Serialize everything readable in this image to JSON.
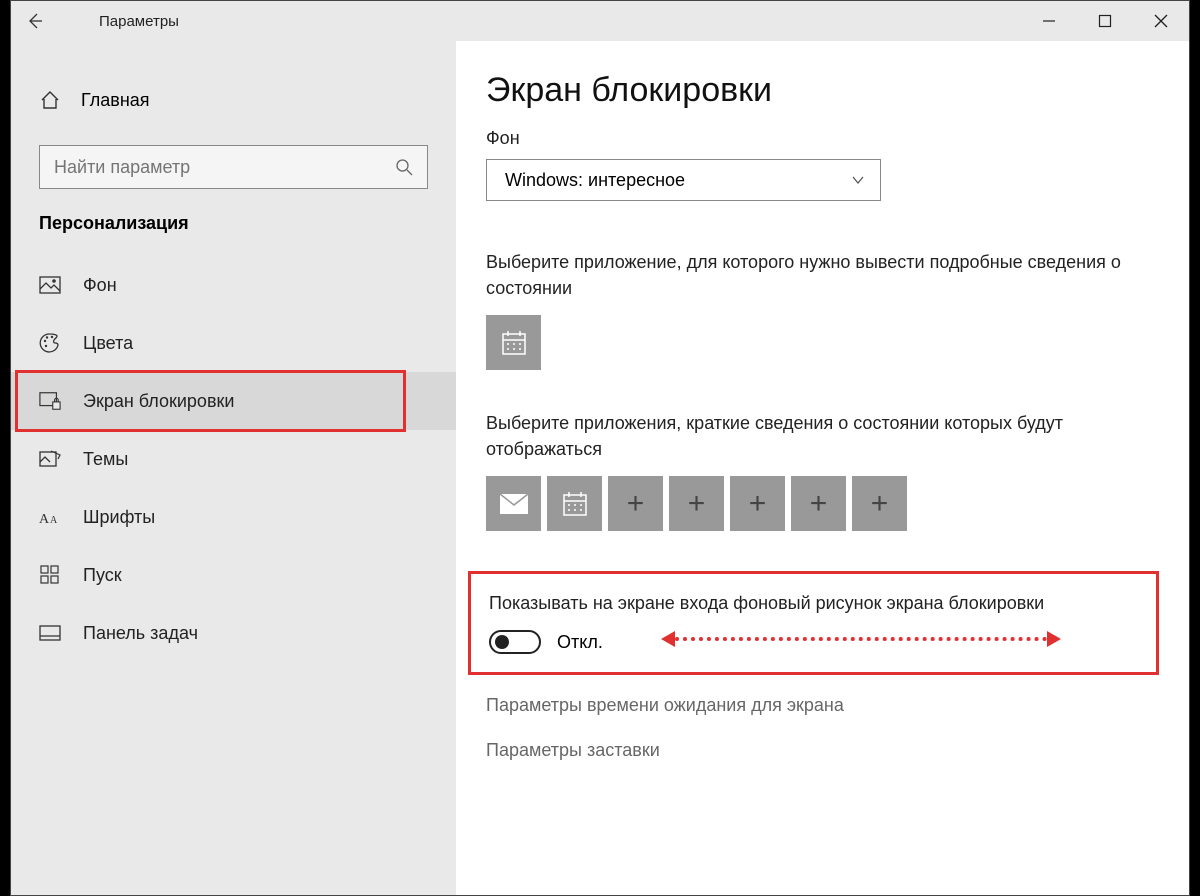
{
  "titlebar": {
    "title": "Параметры"
  },
  "sidebar": {
    "home": "Главная",
    "search_placeholder": "Найти параметр",
    "section": "Персонализация",
    "items": [
      {
        "label": "Фон"
      },
      {
        "label": "Цвета"
      },
      {
        "label": "Экран блокировки"
      },
      {
        "label": "Темы"
      },
      {
        "label": "Шрифты"
      },
      {
        "label": "Пуск"
      },
      {
        "label": "Панель задач"
      }
    ]
  },
  "main": {
    "title": "Экран блокировки",
    "background_label": "Фон",
    "background_value": "Windows: интересное",
    "detailed_label": "Выберите приложение, для которого нужно вывести подробные сведения о состоянии",
    "quick_label": "Выберите приложения, краткие сведения о состоянии которых будут отображаться",
    "toggle_label": "Показывать на экране входа фоновый рисунок экрана блокировки",
    "toggle_value": "Откл.",
    "link1": "Параметры времени ожидания для экрана",
    "link2": "Параметры заставки"
  }
}
